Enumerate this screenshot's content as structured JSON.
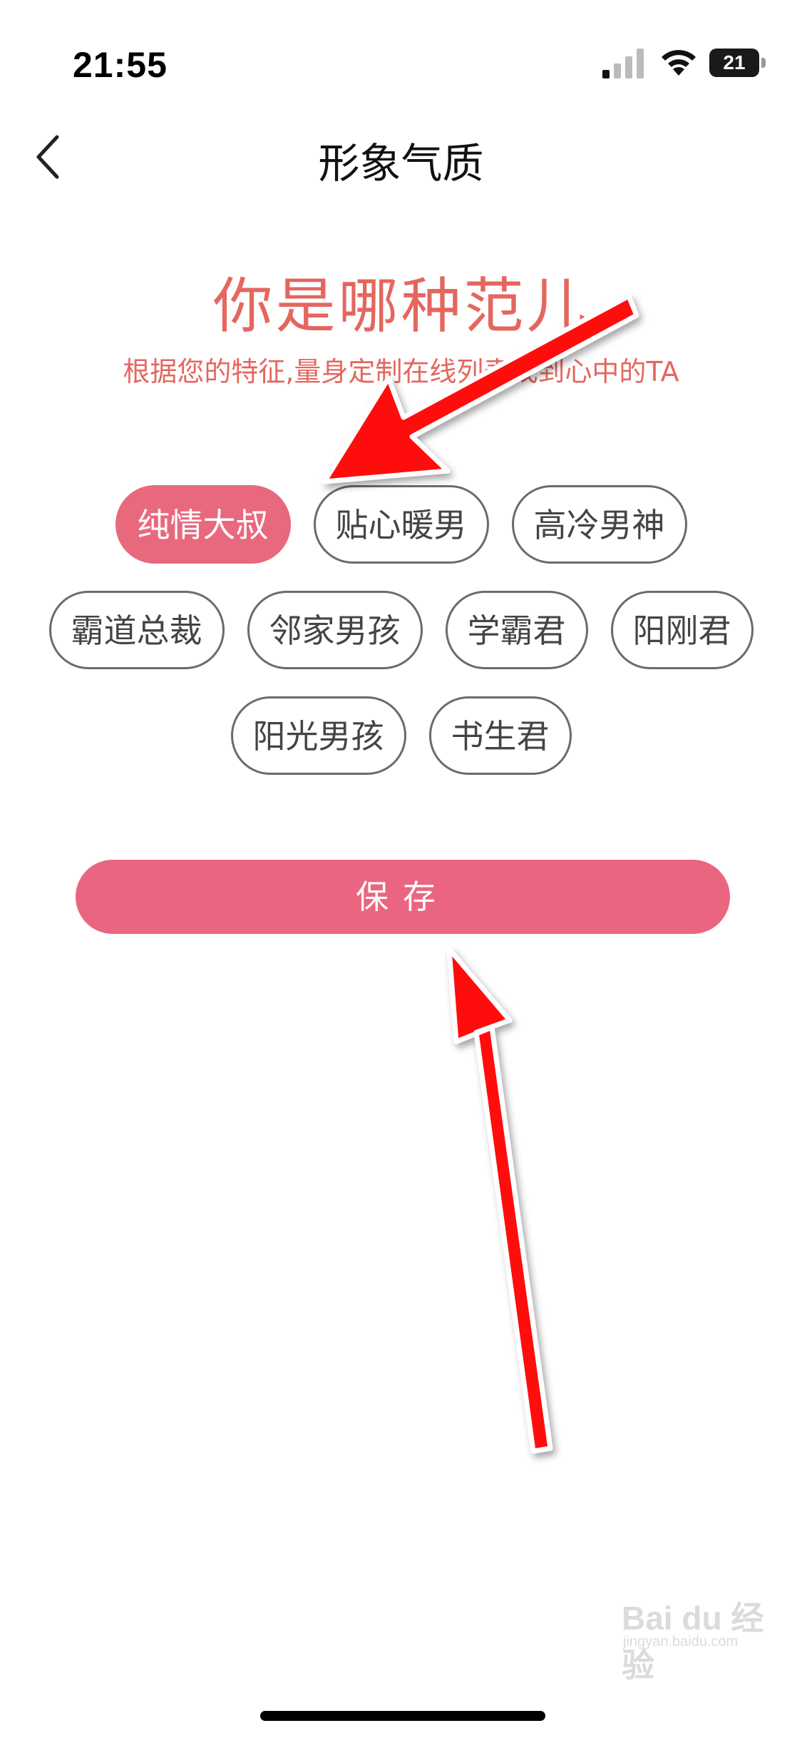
{
  "status_bar": {
    "time": "21:55",
    "battery": "21",
    "signal_icon": "cellular-signal-icon",
    "wifi_icon": "wifi-icon",
    "battery_icon": "battery-icon"
  },
  "nav": {
    "back_icon": "chevron-left-icon",
    "title": "形象气质"
  },
  "header": {
    "title": "你是哪种范儿",
    "subtitle": "根据您的特征,量身定制在线列表找到心中的TA"
  },
  "tags": {
    "rows": [
      [
        {
          "label": "纯情大叔",
          "selected": true
        },
        {
          "label": "贴心暖男",
          "selected": false
        },
        {
          "label": "高冷男神",
          "selected": false
        }
      ],
      [
        {
          "label": "霸道总裁",
          "selected": false
        },
        {
          "label": "邻家男孩",
          "selected": false
        },
        {
          "label": "学霸君",
          "selected": false
        },
        {
          "label": "阳刚君",
          "selected": false
        }
      ],
      [
        {
          "label": "阳光男孩",
          "selected": false
        },
        {
          "label": "书生君",
          "selected": false
        }
      ]
    ]
  },
  "save_label": "保存",
  "colors": {
    "accent": "#ea6680",
    "heading": "#e4675f",
    "annotation_arrow": "#ff0000"
  },
  "watermark": {
    "text": "Bai du 经验",
    "sub": "jingyan.baidu.com"
  }
}
